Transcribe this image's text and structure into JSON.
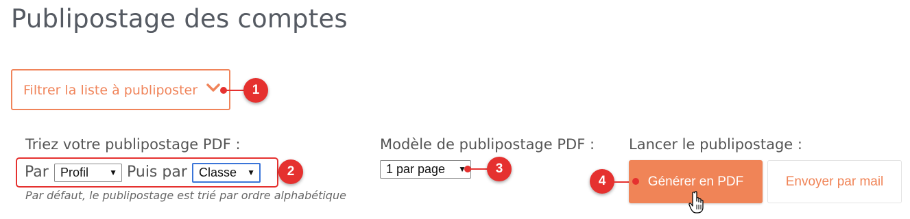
{
  "page": {
    "title": "Publipostage des comptes"
  },
  "filter": {
    "label": "Filtrer la liste à publiposter",
    "chevron_icon": "chevron-down-icon"
  },
  "sort": {
    "label": "Triez votre publipostage PDF :",
    "par_label": "Par",
    "select1_value": "Profil",
    "puis_par_label": "Puis par",
    "select2_value": "Classe",
    "help": "Par défaut, le publipostage est trié par ordre alphabétique"
  },
  "model": {
    "label": "Modèle de publipostage PDF :",
    "select_value": "1 par page"
  },
  "launch": {
    "label": "Lancer le publipostage :",
    "pdf_button": "Générer en PDF",
    "mail_button": "Envoyer par mail"
  },
  "annotations": {
    "badge1": "1",
    "badge2": "2",
    "badge3": "3",
    "badge4": "4"
  },
  "colors": {
    "accent": "#f08457",
    "annotation_red": "#e5312f",
    "focus_blue": "#3a75d8"
  }
}
